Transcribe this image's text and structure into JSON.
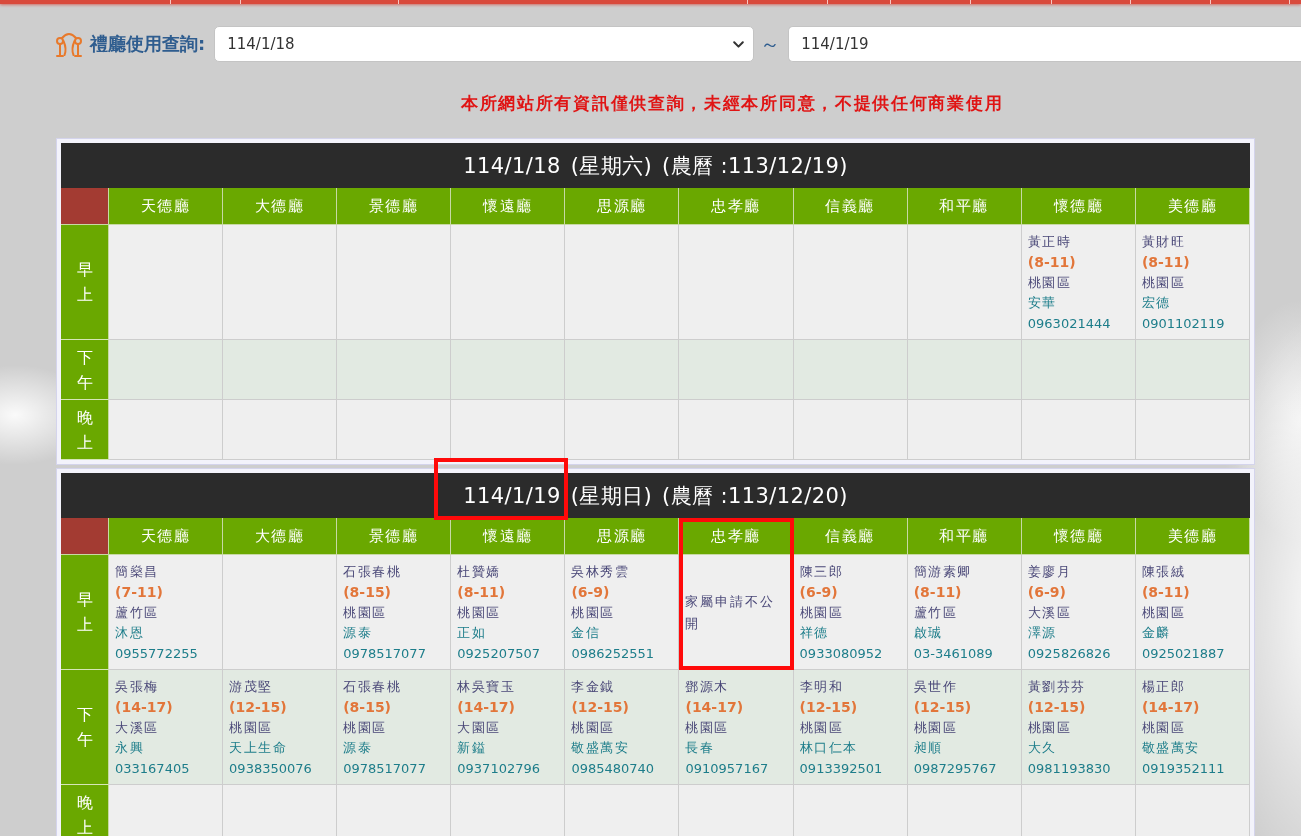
{
  "search": {
    "label": "禮廳使用查詢:",
    "start_date": "114/1/18",
    "separator": "～",
    "end_date": "114/1/19"
  },
  "notice": "本所網站所有資訊僅供查詢，未經本所同意，不提供任何商業使用",
  "days": [
    {
      "date": "114/1/18",
      "weekday": "(星期六)",
      "lunar": "(農曆 :113/12/19)",
      "date_highlighted": false,
      "halls": [
        {
          "name": "天德廳",
          "highlighted": false
        },
        {
          "name": "大德廳",
          "highlighted": false
        },
        {
          "name": "景德廳",
          "highlighted": false
        },
        {
          "name": "懷遠廳",
          "highlighted": false
        },
        {
          "name": "思源廳",
          "highlighted": false
        },
        {
          "name": "忠孝廳",
          "highlighted": false
        },
        {
          "name": "信義廳",
          "highlighted": false
        },
        {
          "name": "和平廳",
          "highlighted": false
        },
        {
          "name": "懷德廳",
          "highlighted": false
        },
        {
          "name": "美德廳",
          "highlighted": false
        }
      ],
      "periods": [
        {
          "label": "早上",
          "slots": [
            {
              "kind": "empty"
            },
            {
              "kind": "empty"
            },
            {
              "kind": "empty"
            },
            {
              "kind": "empty"
            },
            {
              "kind": "empty"
            },
            {
              "kind": "empty"
            },
            {
              "kind": "empty"
            },
            {
              "kind": "empty"
            },
            {
              "kind": "booking",
              "name": "黃正時",
              "time": "(8-11)",
              "district": "桃園區",
              "funeral_home": "安華",
              "phone": "0963021444"
            },
            {
              "kind": "booking",
              "name": "黃財旺",
              "time": "(8-11)",
              "district": "桃園區",
              "funeral_home": "宏德",
              "phone": "0901102119"
            }
          ]
        },
        {
          "label": "下午",
          "slots": [
            {
              "kind": "empty"
            },
            {
              "kind": "empty"
            },
            {
              "kind": "empty"
            },
            {
              "kind": "empty"
            },
            {
              "kind": "empty"
            },
            {
              "kind": "empty"
            },
            {
              "kind": "empty"
            },
            {
              "kind": "empty"
            },
            {
              "kind": "empty"
            },
            {
              "kind": "empty"
            }
          ]
        },
        {
          "label": "晚上",
          "slots": [
            {
              "kind": "empty"
            },
            {
              "kind": "empty"
            },
            {
              "kind": "empty"
            },
            {
              "kind": "empty"
            },
            {
              "kind": "empty"
            },
            {
              "kind": "empty"
            },
            {
              "kind": "empty"
            },
            {
              "kind": "empty"
            },
            {
              "kind": "empty"
            },
            {
              "kind": "empty"
            }
          ]
        }
      ]
    },
    {
      "date": "114/1/19",
      "weekday": "(星期日)",
      "lunar": "(農曆 :113/12/20)",
      "date_highlighted": true,
      "halls": [
        {
          "name": "天德廳",
          "highlighted": false
        },
        {
          "name": "大德廳",
          "highlighted": false
        },
        {
          "name": "景德廳",
          "highlighted": false
        },
        {
          "name": "懷遠廳",
          "highlighted": false
        },
        {
          "name": "思源廳",
          "highlighted": false
        },
        {
          "name": "忠孝廳",
          "highlighted": true
        },
        {
          "name": "信義廳",
          "highlighted": false
        },
        {
          "name": "和平廳",
          "highlighted": false
        },
        {
          "name": "懷德廳",
          "highlighted": false
        },
        {
          "name": "美德廳",
          "highlighted": false
        }
      ],
      "periods": [
        {
          "label": "早上",
          "slots": [
            {
              "kind": "booking",
              "name": "簡燊昌",
              "time": "(7-11)",
              "district": "蘆竹區",
              "funeral_home": "沐恩",
              "phone": "0955772255"
            },
            {
              "kind": "empty"
            },
            {
              "kind": "booking",
              "name": "石張春桃",
              "time": "(8-15)",
              "district": "桃園區",
              "funeral_home": "源泰",
              "phone": "0978517077"
            },
            {
              "kind": "booking",
              "name": "杜贊嬌",
              "time": "(8-11)",
              "district": "桃園區",
              "funeral_home": "正如",
              "phone": "0925207507"
            },
            {
              "kind": "booking",
              "name": "吳林秀雲",
              "time": "(6-9)",
              "district": "桃園區",
              "funeral_home": "金信",
              "phone": "0986252551"
            },
            {
              "kind": "note",
              "text": "家屬申請不公開"
            },
            {
              "kind": "booking",
              "name": "陳三郎",
              "time": "(6-9)",
              "district": "桃園區",
              "funeral_home": "祥德",
              "phone": "0933080952"
            },
            {
              "kind": "booking",
              "name": "簡游素卿",
              "time": "(8-11)",
              "district": "蘆竹區",
              "funeral_home": "啟珹",
              "phone": "03-3461089"
            },
            {
              "kind": "booking",
              "name": "姜廖月",
              "time": "(6-9)",
              "district": "大溪區",
              "funeral_home": "澤源",
              "phone": "0925826826"
            },
            {
              "kind": "booking",
              "name": "陳張絨",
              "time": "(8-11)",
              "district": "桃園區",
              "funeral_home": "金麟",
              "phone": "0925021887"
            }
          ]
        },
        {
          "label": "下午",
          "slots": [
            {
              "kind": "booking",
              "name": "吳張梅",
              "time": "(14-17)",
              "district": "大溪區",
              "funeral_home": "永興",
              "phone": "033167405"
            },
            {
              "kind": "booking",
              "name": "游茂堅",
              "time": "(12-15)",
              "district": "桃園區",
              "funeral_home": "天上生命",
              "phone": "0938350076"
            },
            {
              "kind": "booking",
              "name": "石張春桃",
              "time": "(8-15)",
              "district": "桃園區",
              "funeral_home": "源泰",
              "phone": "0978517077"
            },
            {
              "kind": "booking",
              "name": "林吳寶玉",
              "time": "(14-17)",
              "district": "大園區",
              "funeral_home": "新鎰",
              "phone": "0937102796"
            },
            {
              "kind": "booking",
              "name": "李金鉞",
              "time": "(12-15)",
              "district": "桃園區",
              "funeral_home": "敬盛萬安",
              "phone": "0985480740"
            },
            {
              "kind": "booking",
              "name": "鄧源木",
              "time": "(14-17)",
              "district": "桃園區",
              "funeral_home": "長春",
              "phone": "0910957167"
            },
            {
              "kind": "booking",
              "name": "李明和",
              "time": "(12-15)",
              "district": "桃園區",
              "funeral_home": "林口仁本",
              "phone": "0913392501"
            },
            {
              "kind": "booking",
              "name": "吳世作",
              "time": "(12-15)",
              "district": "桃園區",
              "funeral_home": "昶順",
              "phone": "0987295767"
            },
            {
              "kind": "booking",
              "name": "黃劉芬芬",
              "time": "(12-15)",
              "district": "桃園區",
              "funeral_home": "大久",
              "phone": "0981193830"
            },
            {
              "kind": "booking",
              "name": "楊正郎",
              "time": "(14-17)",
              "district": "桃園區",
              "funeral_home": "敬盛萬安",
              "phone": "0919352111"
            }
          ]
        },
        {
          "label": "晚上",
          "slots": [
            {
              "kind": "empty"
            },
            {
              "kind": "empty"
            },
            {
              "kind": "empty"
            },
            {
              "kind": "empty"
            },
            {
              "kind": "empty"
            },
            {
              "kind": "empty"
            },
            {
              "kind": "empty"
            },
            {
              "kind": "empty"
            },
            {
              "kind": "empty"
            },
            {
              "kind": "empty"
            }
          ]
        }
      ]
    }
  ]
}
